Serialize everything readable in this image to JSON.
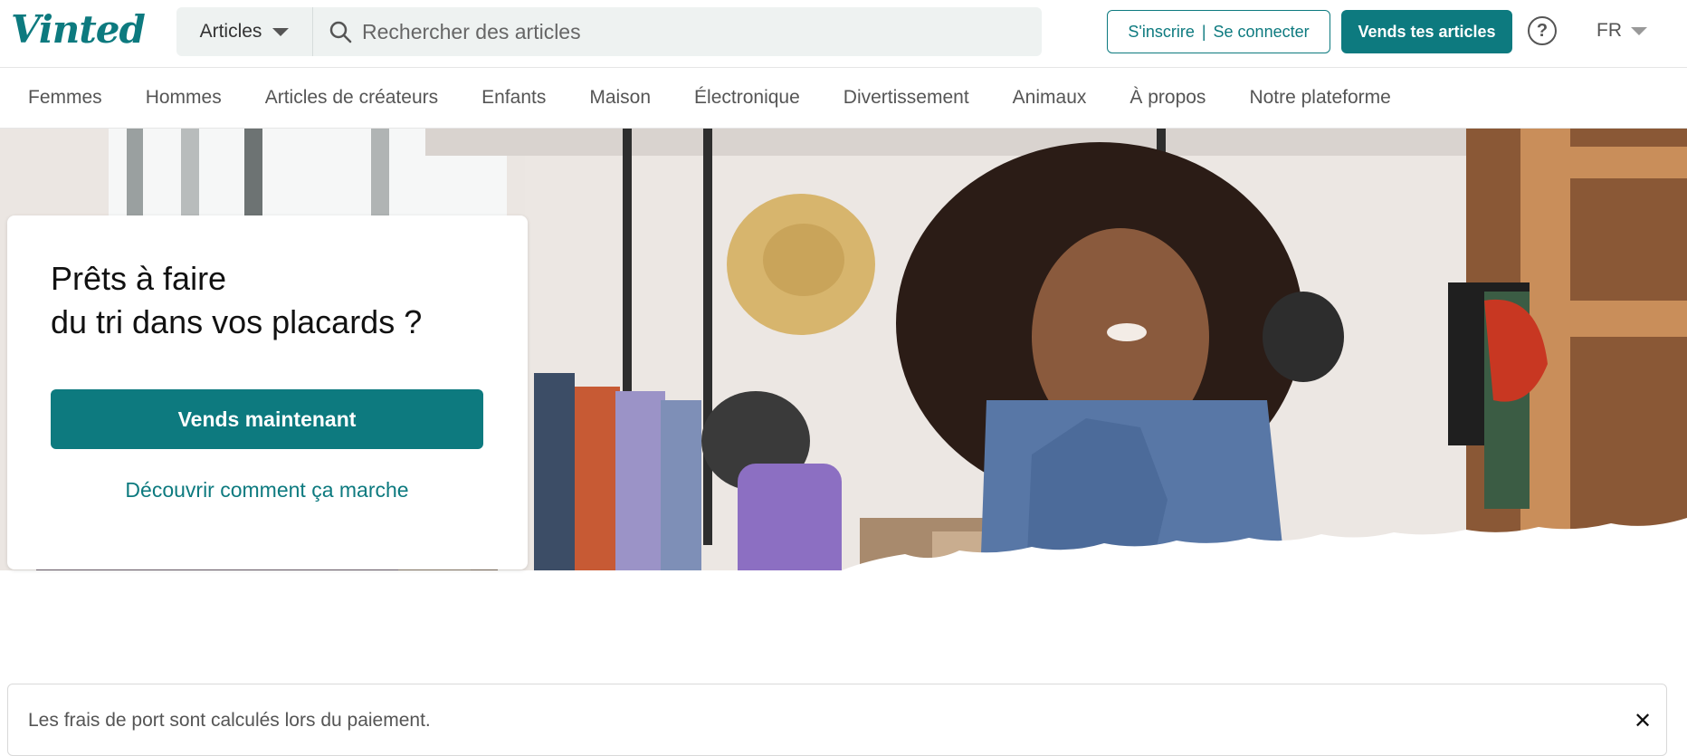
{
  "brand": {
    "logo_text": "Vinted",
    "accent_color": "#0d7a7f"
  },
  "header": {
    "category_select": {
      "value": "Articles",
      "icon": "chevron-down-icon"
    },
    "search": {
      "placeholder": "Rechercher des articles",
      "icon": "search-icon"
    },
    "auth": {
      "signup_label": "S'inscrire",
      "separator": "|",
      "login_label": "Se connecter"
    },
    "sell_label": "Vends tes articles",
    "help_icon": "question-circle-icon",
    "language": "FR"
  },
  "nav": {
    "items": [
      "Femmes",
      "Hommes",
      "Articles de créateurs",
      "Enfants",
      "Maison",
      "Électronique",
      "Divertissement",
      "Animaux",
      "À propos",
      "Notre plateforme"
    ]
  },
  "hero": {
    "title_line1": "Prêts à faire",
    "title_line2": "du tri dans vos placards ?",
    "cta_label": "Vends maintenant",
    "link_label": "Découvrir comment ça marche"
  },
  "banner": {
    "text": "Les frais de port sont calculés lors du paiement.",
    "close_icon": "close-icon",
    "close_glyph": "✕"
  }
}
